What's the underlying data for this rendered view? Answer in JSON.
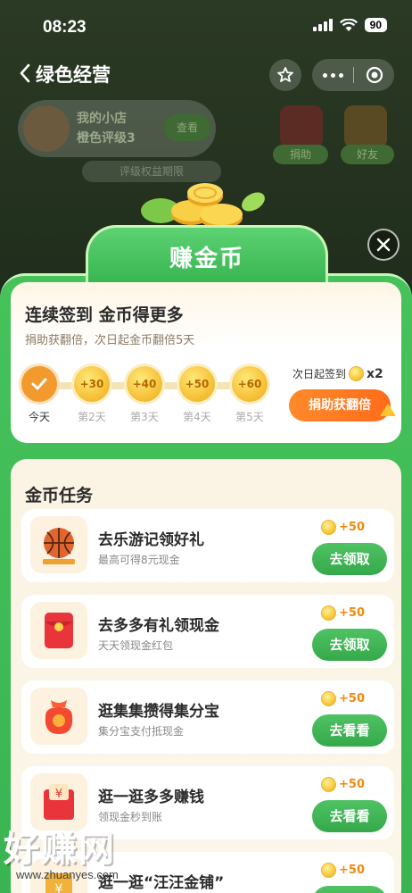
{
  "status_bar": {
    "time": "08:23",
    "battery": "90"
  },
  "nav": {
    "title": "绿色经营"
  },
  "background": {
    "store_name": "我的小店",
    "store_level": "橙色评级3",
    "store_button": "查看",
    "ribbon": "评级权益期限",
    "chip_left": "捐助",
    "chip_right": "好友"
  },
  "modal": {
    "title": "赚金币"
  },
  "checkin": {
    "title": "连续签到 金币得更多",
    "subtitle": "捐助获翻倍，次日起金币翻倍5天",
    "days": [
      {
        "label": "今天",
        "value": "",
        "done": true
      },
      {
        "label": "第2天",
        "value": "+30",
        "done": false
      },
      {
        "label": "第3天",
        "value": "+40",
        "done": false
      },
      {
        "label": "第4天",
        "value": "+50",
        "done": false
      },
      {
        "label": "第5天",
        "value": "+60",
        "done": false
      }
    ],
    "next_day_text": "次日起签到",
    "multiplier": "x2",
    "double_button": "捐助获翻倍"
  },
  "tasks": {
    "title": "金币任务",
    "items": [
      {
        "name": "去乐游记领好礼",
        "desc": "最高可得8元现金",
        "reward": "+50",
        "button": "去领取",
        "icon": "basketball-icon"
      },
      {
        "name": "去多多有礼领现金",
        "desc": "天天领现金红包",
        "reward": "+50",
        "button": "去领取",
        "icon": "red-envelope-icon"
      },
      {
        "name": "逛集集攒得集分宝",
        "desc": "集分宝支付抵现金",
        "reward": "+50",
        "button": "去看看",
        "icon": "lucky-bag-icon"
      },
      {
        "name": "逛一逛多多赚钱",
        "desc": "领现金秒到账",
        "reward": "+50",
        "button": "去看看",
        "icon": "cash-envelope-icon"
      },
      {
        "name": "逛一逛“汪汪金铺”",
        "desc": "",
        "reward": "+50",
        "button": "",
        "icon": "gold-shop-icon"
      }
    ]
  },
  "watermark": {
    "big": "好赚网",
    "small": "www.zhuanyes.com"
  },
  "colors": {
    "accent_green": "#3ab452",
    "orange": "#ff7a22",
    "coin": "#f7c23a"
  }
}
